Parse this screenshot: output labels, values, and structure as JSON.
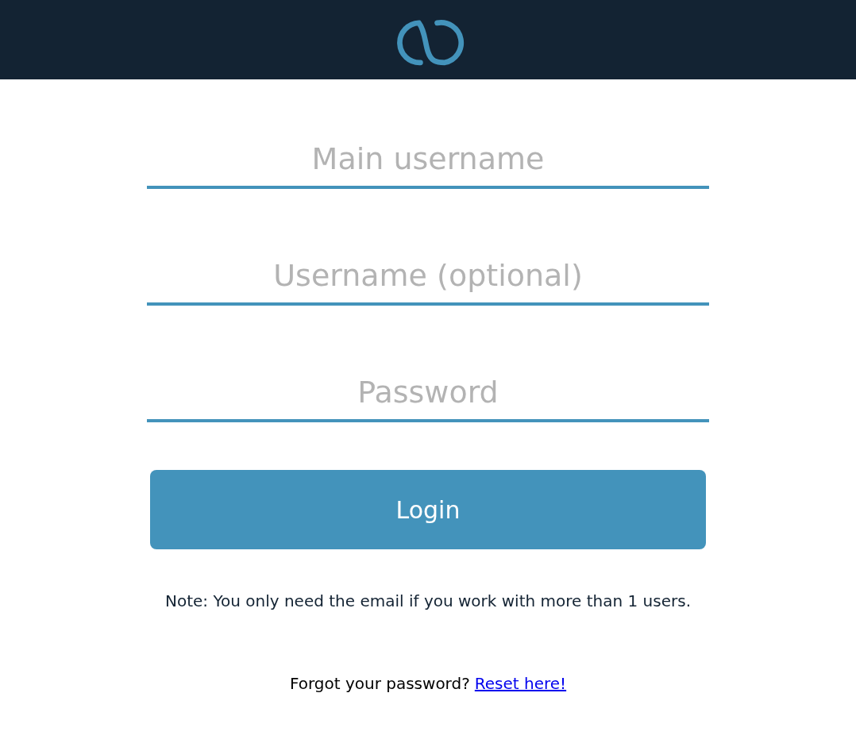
{
  "fields": [
    {
      "placeholder": "Main username"
    },
    {
      "placeholder": "Username (optional)"
    },
    {
      "placeholder": "Password"
    }
  ],
  "button": "Login",
  "note": "Note: You only need the email if you work with more than 1 users.",
  "forgot": {
    "text": "Forgot your password?",
    "link": "Reset here!"
  }
}
